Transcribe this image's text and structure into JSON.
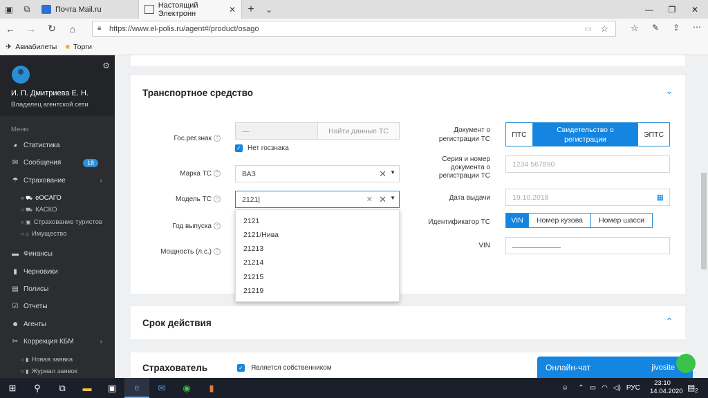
{
  "browser": {
    "tabs": [
      {
        "label": "Почта Mail.ru",
        "icon": "mail-icon"
      },
      {
        "label": "Настоящий Электронн",
        "icon": "page-icon"
      }
    ],
    "url": "https://www.el-polis.ru/agent#/product/osago",
    "bookmarks": [
      "Авиабилеты",
      "Торги"
    ]
  },
  "sidebar": {
    "user_name": "И. П. Дмитриева Е. Н.",
    "user_role": "Владелец агентской сети",
    "menu_header": "Меню",
    "items": [
      {
        "label": "Статистика",
        "icon": "pie-chart-icon"
      },
      {
        "label": "Сообщения",
        "icon": "envelope-icon",
        "badge": "18"
      },
      {
        "label": "Страхование",
        "icon": "umbrella-icon"
      }
    ],
    "insurance_sub": [
      "eОСАГО",
      "КАСКО",
      "Страхование туристов",
      "Имущество"
    ],
    "items2": [
      {
        "label": "Финансы",
        "icon": "money-icon"
      },
      {
        "label": "Черновики",
        "icon": "file-icon"
      },
      {
        "label": "Полисы",
        "icon": "document-icon"
      },
      {
        "label": "Отчеты",
        "icon": "check-square-icon"
      },
      {
        "label": "Агенты",
        "icon": "users-icon"
      },
      {
        "label": "Коррекция КБМ",
        "icon": "scissors-icon"
      }
    ],
    "kbm_sub": [
      "Новая заявка",
      "Журнал заявок"
    ]
  },
  "vehicle": {
    "title": "Транспортное средство",
    "reg_plate_label": "Гос.рег.знак",
    "reg_plate_value": "—",
    "find_button": "Найти данные ТС",
    "no_plate_label": "Нет госзнака",
    "make_label": "Марка ТС",
    "make_value": "ВАЗ",
    "model_label": "Модель ТС",
    "model_value": "2121",
    "year_label": "Год выпуска",
    "power_label": "Мощность (л.с.)",
    "doc_label": "Документ о регистрации ТС",
    "doc_options": [
      "ПТС",
      "Свидетельство о регистрации",
      "ЭПТС"
    ],
    "doc_selected": 1,
    "series_label": "Серия и номер документа о регистрации ТС",
    "series_placeholder": "1234 567890",
    "issue_label": "Дата выдачи",
    "issue_placeholder": "19.10.2018",
    "id_label": "Идентификатор ТС",
    "id_options": [
      "VIN",
      "Номер кузова",
      "Номер шасси"
    ],
    "id_selected": 0,
    "vin_label": "VIN",
    "model_options": [
      "2121",
      "2121/Нива",
      "21213",
      "21214",
      "21215",
      "21219"
    ]
  },
  "period": {
    "title": "Срок действия"
  },
  "insurer": {
    "title": "Страхователь",
    "owner_label": "Является собственником"
  },
  "chat": {
    "label": "Онлайн-чат",
    "brand": "jivosite"
  },
  "taskbar": {
    "lang": "РУС",
    "time": "23:10",
    "date": "14.04.2020",
    "notif": "2"
  },
  "colors": {
    "accent": "#1485e0",
    "sidebar": "#2b2d31",
    "badge": "#2c8fd6"
  }
}
